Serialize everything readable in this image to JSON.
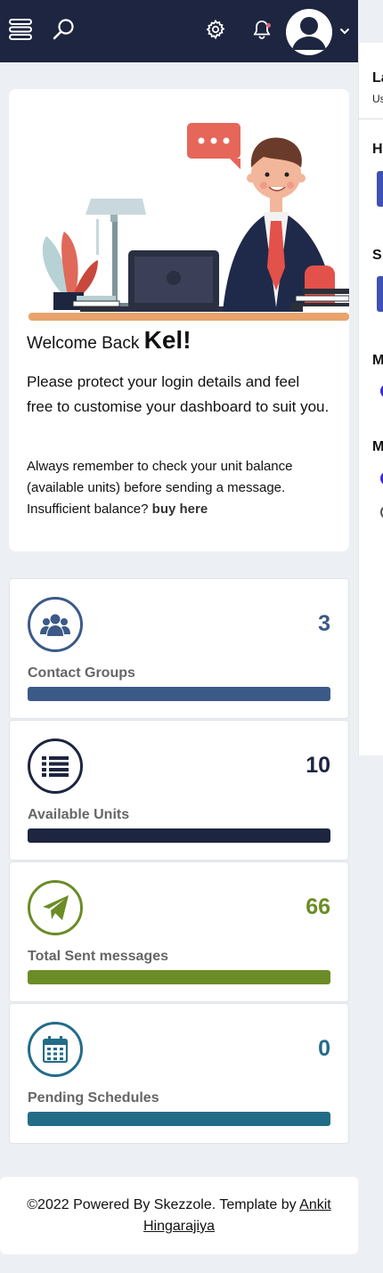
{
  "sidepanel": {
    "title": "La",
    "subtitle": "Us",
    "h1": "H",
    "h2": "S",
    "h3": "M",
    "h4": "M"
  },
  "welcome": {
    "greeting": "Welcome Back",
    "name": "Kel!",
    "para1": "Please protect your login details and feel free to customise your dashboard to suit you.",
    "para2": "Always remember to check your unit balance (available units) before sending a message. Insufficient balance?",
    "buy_link": "buy here"
  },
  "stats": [
    {
      "value": "3",
      "label": "Contact Groups",
      "color": "#3b5a87",
      "icon": "users-icon"
    },
    {
      "value": "10",
      "label": "Available Units",
      "color": "#1d2540",
      "icon": "list-icon"
    },
    {
      "value": "66",
      "label": "Total Sent messages",
      "color": "#6b8c27",
      "icon": "paper-plane-icon"
    },
    {
      "value": "0",
      "label": "Pending Schedules",
      "color": "#236c88",
      "icon": "calendar-icon"
    }
  ],
  "footer": {
    "text": "©2022 Powered By Skezzole. Template by",
    "author": "Ankit Hingarajiya"
  }
}
